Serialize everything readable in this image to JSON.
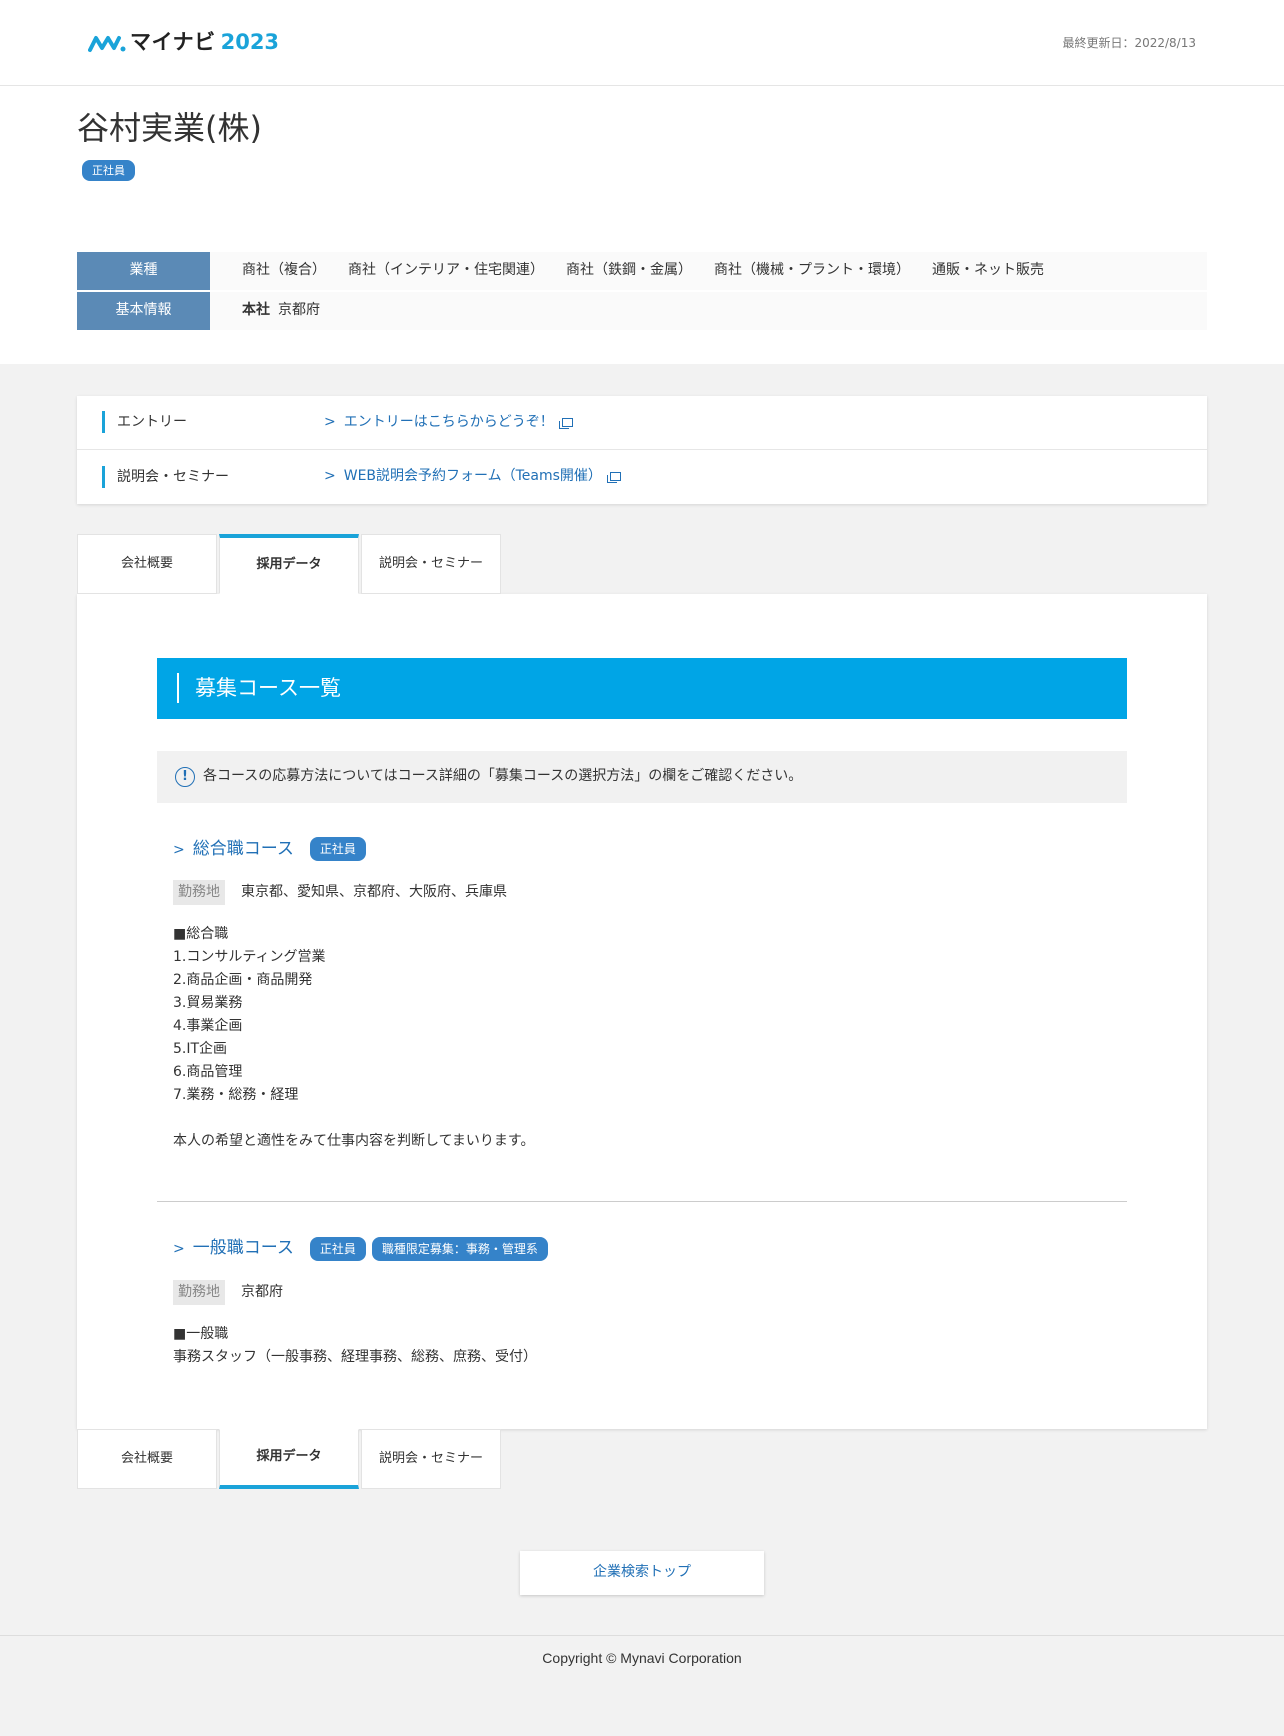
{
  "header": {
    "logo_text": "マイナビ",
    "logo_year": "2023",
    "updated": "最終更新日：2022/8/13"
  },
  "company": {
    "name": "谷村実業(株)",
    "badge": "正社員"
  },
  "info": {
    "industry_label": "業種",
    "industries": [
      "商社（複合）",
      "商社（インテリア・住宅関連）",
      "商社（鉄鋼・金属）",
      "商社（機械・プラント・環境）",
      "通販・ネット販売"
    ],
    "basic_label": "基本情報",
    "hq_label": "本社",
    "hq_value": "京都府"
  },
  "links": [
    {
      "label": "エントリー",
      "text": "エントリーはこちらからどうぞ！"
    },
    {
      "label": "説明会・セミナー",
      "text": "WEB説明会予約フォーム（Teams開催）"
    }
  ],
  "tabs": [
    "会社概要",
    "採用データ",
    "説明会・セミナー"
  ],
  "section": {
    "title": "募集コース一覧",
    "notice": "各コースの応募方法についてはコース詳細の「募集コースの選択方法」の欄をご確認ください。"
  },
  "courses": [
    {
      "title": "総合職コース",
      "badges": [
        "正社員"
      ],
      "loc_label": "勤務地",
      "loc_value": "東京都、愛知県、京都府、大阪府、兵庫県",
      "desc": "■総合職\n1.コンサルティング営業\n2.商品企画・商品開発\n3.貿易業務\n4.事業企画\n5.IT企画\n6.商品管理\n7.業務・総務・経理\n\n本人の希望と適性をみて仕事内容を判断してまいります。"
    },
    {
      "title": "一般職コース",
      "badges": [
        "正社員",
        "職種限定募集：事務・管理系"
      ],
      "loc_label": "勤務地",
      "loc_value": "京都府",
      "desc": "■一般職\n事務スタッフ（一般事務、経理事務、総務、庶務、受付）"
    }
  ],
  "footer": {
    "search_top": "企業検索トップ",
    "copyright": "Copyright © Mynavi Corporation"
  },
  "colors": {
    "accent": "#00a5e6",
    "link": "#2170b6",
    "badge": "#3583c9",
    "info_head": "#5b8ab6"
  }
}
